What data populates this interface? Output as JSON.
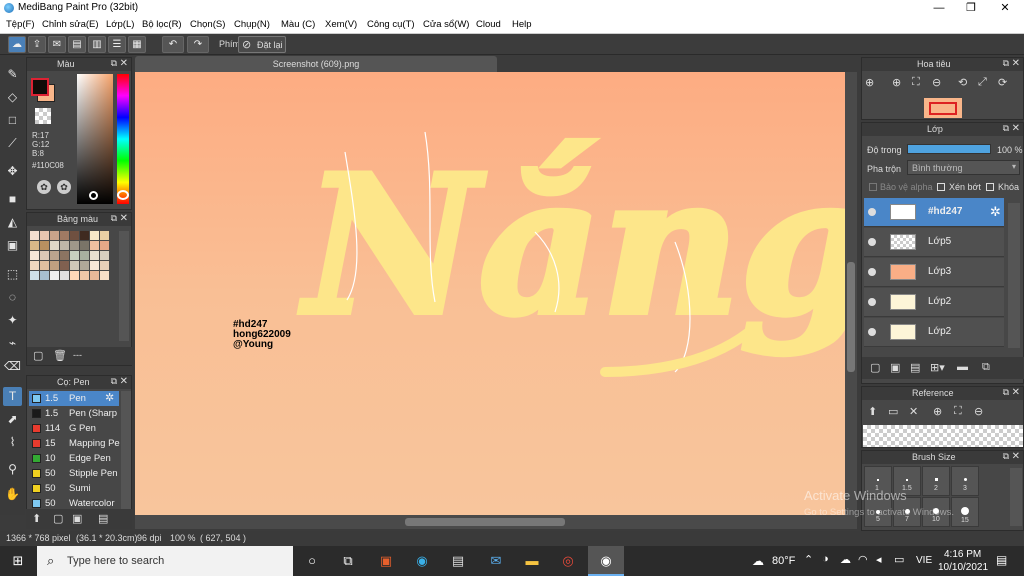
{
  "window": {
    "title": "MediBang Paint Pro (32bit)",
    "min": "—",
    "max": "❐",
    "close": "✕"
  },
  "menu": [
    "Tệp(F)",
    "Chỉnh sửa(E)",
    "Lớp(L)",
    "Bộ lọc(R)",
    "Chọn(S)",
    "Chụp(N)",
    "Màu (C)",
    "Xem(V)",
    "Công cụ(T)",
    "Cửa sổ(W)",
    "Cloud",
    "Help"
  ],
  "toolbar": {
    "key_label": "Phím",
    "reset_label": "Đặt lại"
  },
  "color_panel": {
    "title": "Màu",
    "r": "R:17",
    "g": "G:12",
    "b": "B:8",
    "hex": "#110C08",
    "primary_color": "#110C08",
    "secondary_color": "#F9B68A"
  },
  "palette_panel": {
    "title": "Bảng màu",
    "footer_label": "---"
  },
  "brush_panel": {
    "title": "Cọ: Pen",
    "brushes": [
      {
        "size": "1.5",
        "name": "Pen",
        "color": "#7ec8f0"
      },
      {
        "size": "1.5",
        "name": "Pen (Sharp",
        "color": "#1a1a1a"
      },
      {
        "size": "114",
        "name": "G Pen",
        "color": "#e83b2e"
      },
      {
        "size": "15",
        "name": "Mapping Pe",
        "color": "#e83b2e"
      },
      {
        "size": "10",
        "name": "Edge Pen",
        "color": "#33aa33"
      },
      {
        "size": "50",
        "name": "Stipple Pen",
        "color": "#f0d020"
      },
      {
        "size": "50",
        "name": "Sumi",
        "color": "#f0d020"
      },
      {
        "size": "50",
        "name": "Watercolor",
        "color": "#7ec8f0"
      }
    ]
  },
  "document_tab": "Screenshot (609).png",
  "canvas": {
    "lettering": "Nắng",
    "signature": [
      "#hd247",
      "hong622009",
      "@Young"
    ]
  },
  "navigator_panel": {
    "title": "Hoa tiêu"
  },
  "layer_panel": {
    "title": "Lớp",
    "opacity_label": "Độ trong",
    "opacity_value": "100 %",
    "blend_label": "Pha trộn",
    "blend_value": "Bình thường",
    "protect_alpha": "Bảo vệ alpha",
    "clipping": "Xén bớt",
    "lock": "Khóa",
    "layers": [
      "#hd247",
      "Lớp5",
      "Lớp3",
      "Lớp2",
      "Lớp2"
    ]
  },
  "reference_panel": {
    "title": "Reference"
  },
  "brush_size_panel": {
    "title": "Brush Size",
    "sizes": [
      "1",
      "1.5",
      "2",
      "3",
      "5",
      "7",
      "10",
      "15"
    ]
  },
  "watermark": {
    "line1": "Activate Windows",
    "line2": "Go to Settings to activate Windows."
  },
  "status": {
    "dims": "1366 * 768 pixel",
    "cm": "(36.1 * 20.3cm)",
    "dpi": "96 dpi",
    "zoom": "100 %",
    "coords": "( 627, 504 )"
  },
  "taskbar": {
    "search_placeholder": "Type here to search",
    "weather": "80°F",
    "lang": "VIE",
    "time": "4:16 PM",
    "date": "10/10/2021"
  }
}
